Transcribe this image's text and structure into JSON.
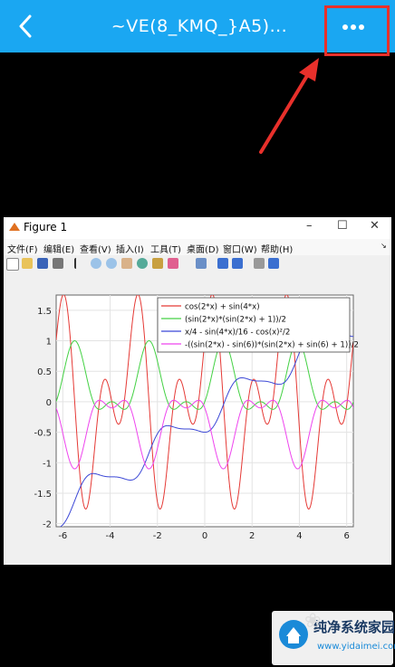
{
  "app": {
    "title": "~VE(8_KMQ_}A5)...",
    "back_icon": "chevron-left-icon",
    "more_icon": "more-dots-icon",
    "highlight_color": "#e8302b",
    "bar_color": "#1aa7f2"
  },
  "figure": {
    "window_title": "Figure 1",
    "menu": [
      "文件(F)",
      "编辑(E)",
      "查看(V)",
      "插入(I)",
      "工具(T)",
      "桌面(D)",
      "窗口(W)",
      "帮助(H)"
    ]
  },
  "chart_data": {
    "type": "line",
    "xlim": [
      -6.28,
      6.28
    ],
    "ylim": [
      -2.05,
      1.75
    ],
    "xticks": [
      "-6",
      "-4",
      "-2",
      "0",
      "2",
      "4",
      "6"
    ],
    "yticks": [
      "1.5",
      "1",
      "0.5",
      "0",
      "-0.5",
      "-1",
      "-1.5",
      "-2"
    ],
    "grid": true,
    "legend_position": "top-right",
    "series": [
      {
        "name": "cos(2*x) + sin(4*x)",
        "color": "#e53935",
        "fn": "f1"
      },
      {
        "name": "(sin(2*x)*(sin(2*x) + 1))/2",
        "color": "#43d143",
        "fn": "f2"
      },
      {
        "name": "x/4 - sin(4*x)/16 - cos(x)²/2",
        "color": "#3b47d6",
        "fn": "f3"
      },
      {
        "name": "-((sin(2*x) - sin(6))*(sin(2*x) + sin(6) + 1))/2",
        "color": "#ee44ee",
        "fn": "f4"
      }
    ]
  },
  "watermark": {
    "title": "纯净系统家园",
    "url": "www.yidaimei.com"
  }
}
